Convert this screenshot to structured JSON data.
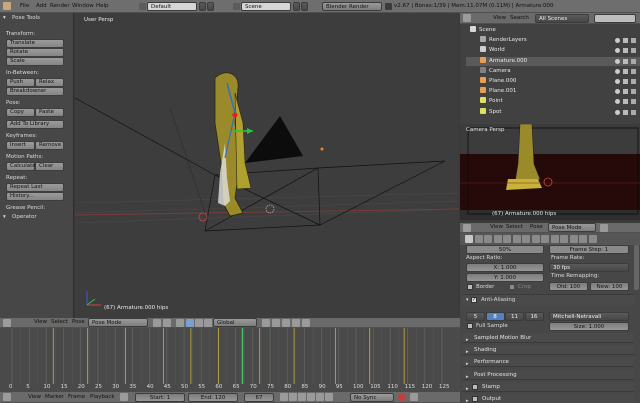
{
  "top_bar": {
    "menus": [
      "File",
      "Add",
      "Render",
      "Window",
      "Help"
    ],
    "layout": "Default",
    "scene": "Scene",
    "engine": "Blender Render",
    "info": "v2.67 | Bones:1/39 | Mem:11.07M (0.11M) | Armature.000"
  },
  "tool_shelf": {
    "title": "Pose Tools",
    "transform_label": "Transform:",
    "translate": "Translate",
    "rotate": "Rotate",
    "scale": "Scale",
    "inbetween_label": "In-Between:",
    "push": "Push",
    "relax": "Relax",
    "breakdowner": "Breakdowner",
    "pose_label": "Pose:",
    "copy": "Copy",
    "paste": "Paste",
    "add_to_library": "Add To Library",
    "keyframes_label": "Keyframes:",
    "insert": "Insert",
    "remove": "Remove",
    "motion_paths_label": "Motion Paths:",
    "calculate": "Calculate",
    "clear": "Clear",
    "repeat_label": "Repeat:",
    "repeat_last": "Repeat Last",
    "history": "History...",
    "grease_pencil_label": "Grease Pencil:",
    "operator": "Operator"
  },
  "viewport": {
    "view_label": "User Persp",
    "status": "(67) Armature.000 hips",
    "menus": [
      "View",
      "Select",
      "Pose"
    ],
    "mode": "Pose Mode",
    "orientation": "Global"
  },
  "outliner": {
    "menus": [
      "View",
      "Search"
    ],
    "filter": "All Scenes",
    "items": [
      {
        "name": "Scene",
        "indent": 0
      },
      {
        "name": "RenderLayers",
        "indent": 1
      },
      {
        "name": "World",
        "indent": 1
      },
      {
        "name": "Armature.000",
        "indent": 1
      },
      {
        "name": "Camera",
        "indent": 1
      },
      {
        "name": "Plane.000",
        "indent": 1
      },
      {
        "name": "Plane.001",
        "indent": 1
      },
      {
        "name": "Point",
        "indent": 1
      },
      {
        "name": "Spot",
        "indent": 1
      }
    ]
  },
  "camera_view": {
    "label": "Camera Persp",
    "status": "(67) Armature.000 hips"
  },
  "properties": {
    "menus": [
      "View",
      "Select",
      "Pose"
    ],
    "mode": "Pose Mode",
    "percent": "50%",
    "frame_step": "Frame Step: 1",
    "aspect_ratio_label": "Aspect Ratio:",
    "aspect_x": "X: 1.000",
    "aspect_y": "Y: 1.000",
    "frame_rate_label": "Frame Rate:",
    "fps": "30 fps",
    "time_remapping_label": "Time Remapping:",
    "old": "Old: 100",
    "new": "New: 100",
    "border": "Border",
    "crop": "Crop",
    "anti_aliasing": "Anti-Aliasing",
    "aa_samples": [
      "5",
      "8",
      "11",
      "16"
    ],
    "aa_selected": "8",
    "filter": "Mitchell-Netravali",
    "full_sample": "Full Sample",
    "size": "Size: 1.000",
    "sections": [
      "Sampled Motion Blur",
      "Shading",
      "Performance",
      "Post Processing",
      "Stamp",
      "Output"
    ]
  },
  "timeline": {
    "menus": [
      "View",
      "Marker",
      "Frame",
      "Playback"
    ],
    "start": "Start: 1",
    "end": "End: 120",
    "current": "67",
    "sync": "No Sync",
    "ticks": [
      "0",
      "5",
      "10",
      "15",
      "20",
      "25",
      "30",
      "35",
      "40",
      "45",
      "50",
      "55",
      "60",
      "65",
      "70",
      "75",
      "80",
      "85",
      "90",
      "95",
      "100",
      "105",
      "110",
      "115",
      "120",
      "125"
    ]
  },
  "dopesheet": {
    "menus": [
      "View",
      "Select",
      "Pose"
    ],
    "mode": "Pose Mode",
    "orientation": "Global"
  }
}
